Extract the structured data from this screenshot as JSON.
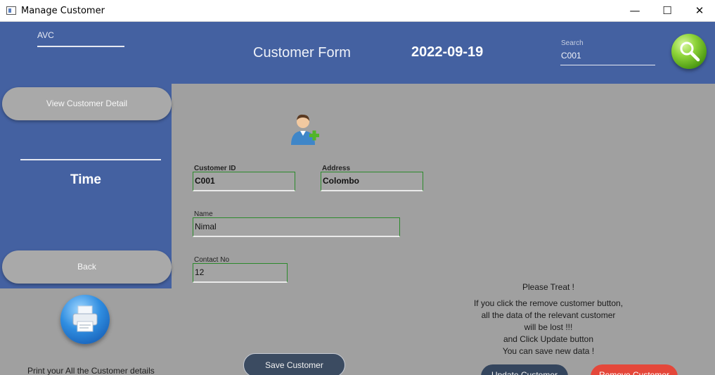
{
  "window": {
    "title": "Manage Customer",
    "minimize_glyph": "—",
    "maximize_glyph": "☐",
    "close_glyph": "✕"
  },
  "header": {
    "user_field": "AVC",
    "form_title": "Customer Form",
    "date": "2022-09-19",
    "search_label": "Search",
    "search_value": "C001",
    "search_icon": "magnifier-icon"
  },
  "sidebar": {
    "view_button": "View Customer Detail",
    "time_label": "Time",
    "back_button": "Back"
  },
  "print": {
    "icon": "printer-icon",
    "caption": "Print your All the Customer details"
  },
  "form": {
    "icon": "add-user-icon",
    "customer_id_label": "Customer ID",
    "customer_id": "C001",
    "address_label": "Address",
    "address": "Colombo",
    "name_label": "Name",
    "name": "Nimal",
    "contact_label": "Contact No",
    "contact": "12",
    "save_button": "Save Customer"
  },
  "notice": {
    "line1": "Please Treat !",
    "line2": "If you click the remove customer button,",
    "line3": "all the data of the relevant customer",
    "line4": "will be lost !!!",
    "line5": "and Click Update button",
    "line6": "You can save new data !"
  },
  "actions": {
    "update_button": "Update Customer",
    "remove_button": "Remove Customer"
  },
  "colors": {
    "header_blue": "#4461a1",
    "body_gray": "#a0a0a0",
    "field_border_green": "#2c8a2c",
    "save_button": "#3b4b61",
    "remove_button": "#e4473a"
  }
}
